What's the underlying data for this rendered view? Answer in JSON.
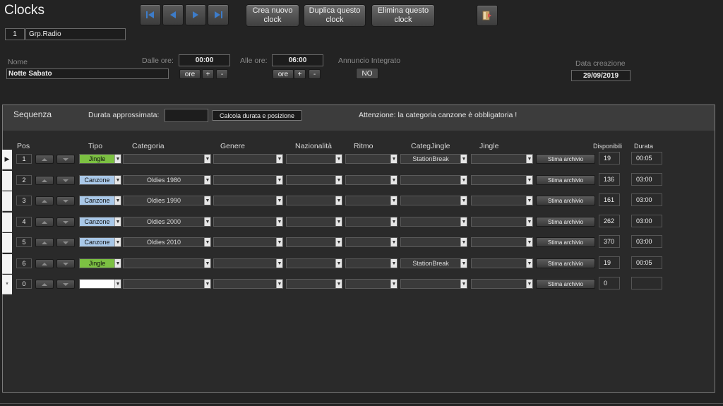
{
  "header": {
    "title": "Clocks",
    "id": "1",
    "group": "Grp.Radio",
    "buttons": {
      "new": "Crea nuovo clock",
      "duplicate": "Duplica questo clock",
      "delete": "Elimina questo clock"
    }
  },
  "form": {
    "nome_label": "Nome",
    "nome_value": "Notte Sabato",
    "dalle_label": "Dalle ore:",
    "dalle_value": "00:00",
    "alle_label": "Alle ore:",
    "alle_value": "06:00",
    "ore_label": "ore",
    "plus_label": "+",
    "minus_label": "-",
    "annuncio_label": "Annuncio Integrato",
    "annuncio_value": "NO",
    "data_label": "Data creazione",
    "data_value": "29/09/2019"
  },
  "sequenza": {
    "title": "Sequenza",
    "durata_label": "Durata approssimata:",
    "durata_value": "",
    "calcola_label": "Calcola durata e posizione",
    "warning": "Attenzione: la categoria canzone è obbligatoria !"
  },
  "columns": {
    "pos": "Pos",
    "tipo": "Tipo",
    "categoria": "Categoria",
    "genere": "Genere",
    "nazionalita": "Nazionalità",
    "ritmo": "Ritmo",
    "categjingle": "CategJingle",
    "jingle": "Jingle",
    "disponibili": "Disponibili",
    "durata": "Durata"
  },
  "stima_label": "Stima archivio",
  "rows": [
    {
      "marker": "▶",
      "pos": "1",
      "tipo": "Jingle",
      "tipo_color": "#7cc142",
      "categoria": "",
      "genere": "",
      "nazionalita": "",
      "ritmo": "",
      "categjingle": "StationBreak",
      "jingle": "",
      "disponibili": "19",
      "durata": "00:05"
    },
    {
      "marker": "",
      "pos": "2",
      "tipo": "Canzone",
      "tipo_color": "#a9c8e8",
      "categoria": "Oldies 1980",
      "genere": "",
      "nazionalita": "",
      "ritmo": "",
      "categjingle": "",
      "jingle": "",
      "disponibili": "136",
      "durata": "03:00"
    },
    {
      "marker": "",
      "pos": "3",
      "tipo": "Canzone",
      "tipo_color": "#a9c8e8",
      "categoria": "Oldies 1990",
      "genere": "",
      "nazionalita": "",
      "ritmo": "",
      "categjingle": "",
      "jingle": "",
      "disponibili": "161",
      "durata": "03:00"
    },
    {
      "marker": "",
      "pos": "4",
      "tipo": "Canzone",
      "tipo_color": "#a9c8e8",
      "categoria": "Oldies 2000",
      "genere": "",
      "nazionalita": "",
      "ritmo": "",
      "categjingle": "",
      "jingle": "",
      "disponibili": "262",
      "durata": "03:00"
    },
    {
      "marker": "",
      "pos": "5",
      "tipo": "Canzone",
      "tipo_color": "#a9c8e8",
      "categoria": "Oldies 2010",
      "genere": "",
      "nazionalita": "",
      "ritmo": "",
      "categjingle": "",
      "jingle": "",
      "disponibili": "370",
      "durata": "03:00"
    },
    {
      "marker": "",
      "pos": "6",
      "tipo": "Jingle",
      "tipo_color": "#7cc142",
      "categoria": "",
      "genere": "",
      "nazionalita": "",
      "ritmo": "",
      "categjingle": "StationBreak",
      "jingle": "",
      "disponibili": "19",
      "durata": "00:05"
    },
    {
      "marker": "*",
      "pos": "0",
      "tipo": "",
      "tipo_color": "#ffffff",
      "categoria": "",
      "genere": "",
      "nazionalita": "",
      "ritmo": "",
      "categjingle": "",
      "jingle": "",
      "disponibili": "0",
      "durata": ""
    }
  ]
}
